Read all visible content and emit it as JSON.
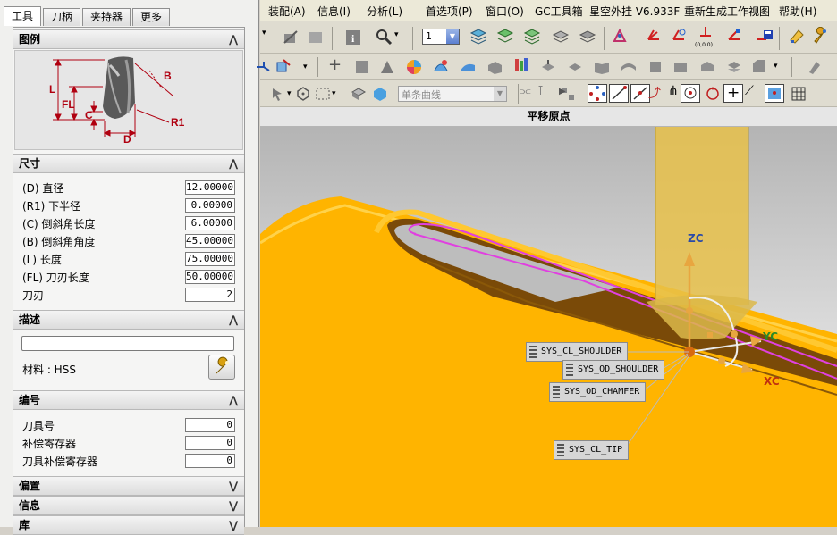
{
  "tabs": [
    {
      "label": "工具"
    },
    {
      "label": "刀柄"
    },
    {
      "label": "夹持器"
    },
    {
      "label": "更多"
    }
  ],
  "sections": {
    "legend": {
      "title": "图例"
    },
    "dimensions": {
      "title": "尺寸"
    },
    "description": {
      "title": "描述"
    },
    "numbering": {
      "title": "编号"
    },
    "offset": {
      "title": "偏置"
    },
    "info": {
      "title": "信息"
    },
    "library": {
      "title": "库"
    }
  },
  "legend_labels": {
    "L": "L",
    "FL": "FL",
    "C": "C",
    "D": "D",
    "B": "B",
    "R1": "R1"
  },
  "dimensions": [
    {
      "label": "(D) 直径",
      "value": "12.00000"
    },
    {
      "label": "(R1) 下半径",
      "value": "0.00000"
    },
    {
      "label": "(C) 倒斜角长度",
      "value": "6.00000"
    },
    {
      "label": "(B) 倒斜角角度",
      "value": "45.00000"
    },
    {
      "label": "(L) 长度",
      "value": "75.00000"
    },
    {
      "label": "(FL) 刀刃长度",
      "value": "50.00000"
    },
    {
      "label": "刀刃",
      "value": "2"
    }
  ],
  "description": {
    "input_value": "",
    "material_label": "材料 : HSS"
  },
  "numbering": [
    {
      "label": "刀具号",
      "value": "0"
    },
    {
      "label": "补偿寄存器",
      "value": "0"
    },
    {
      "label": "刀具补偿寄存器",
      "value": "0"
    }
  ],
  "menubar": [
    {
      "label": "装配(A)"
    },
    {
      "label": "信息(I)"
    },
    {
      "label": "分析(L)"
    },
    {
      "label": "首选项(P)"
    },
    {
      "label": "窗口(O)"
    },
    {
      "label": "GC工具箱"
    },
    {
      "label": "星空外挂 V6.933F"
    },
    {
      "label": "重新生成工作视图"
    },
    {
      "label": "帮助(H)"
    }
  ],
  "toolbar": {
    "layer_select_value": "1",
    "curve_filter_placeholder": "单条曲线",
    "coord_label": "(0,0,0)"
  },
  "view_title": "平移原点",
  "viewport": {
    "axis_labels": {
      "zc": "ZC",
      "yc": "YC",
      "xc": "XC"
    },
    "tags": [
      {
        "text": "SYS_CL_SHOULDER"
      },
      {
        "text": "SYS_OD_SHOULDER"
      },
      {
        "text": "SYS_OD_CHAMFER"
      },
      {
        "text": "SYS_CL_TIP"
      }
    ]
  },
  "colors": {
    "part": "#ffb400",
    "part_dark": "#7a4a08",
    "tool": "#e8c14a",
    "toolpath": "#e040e0",
    "axis_z": "#e8a640",
    "label_y": "#2a8a2a",
    "label_x": "#c03010"
  },
  "icons": [
    "chevron-up-icon",
    "chevron-down-icon",
    "wrench-icon",
    "magnifier-icon",
    "info-icon",
    "save-icon",
    "layer-icon",
    "snap-icon"
  ]
}
